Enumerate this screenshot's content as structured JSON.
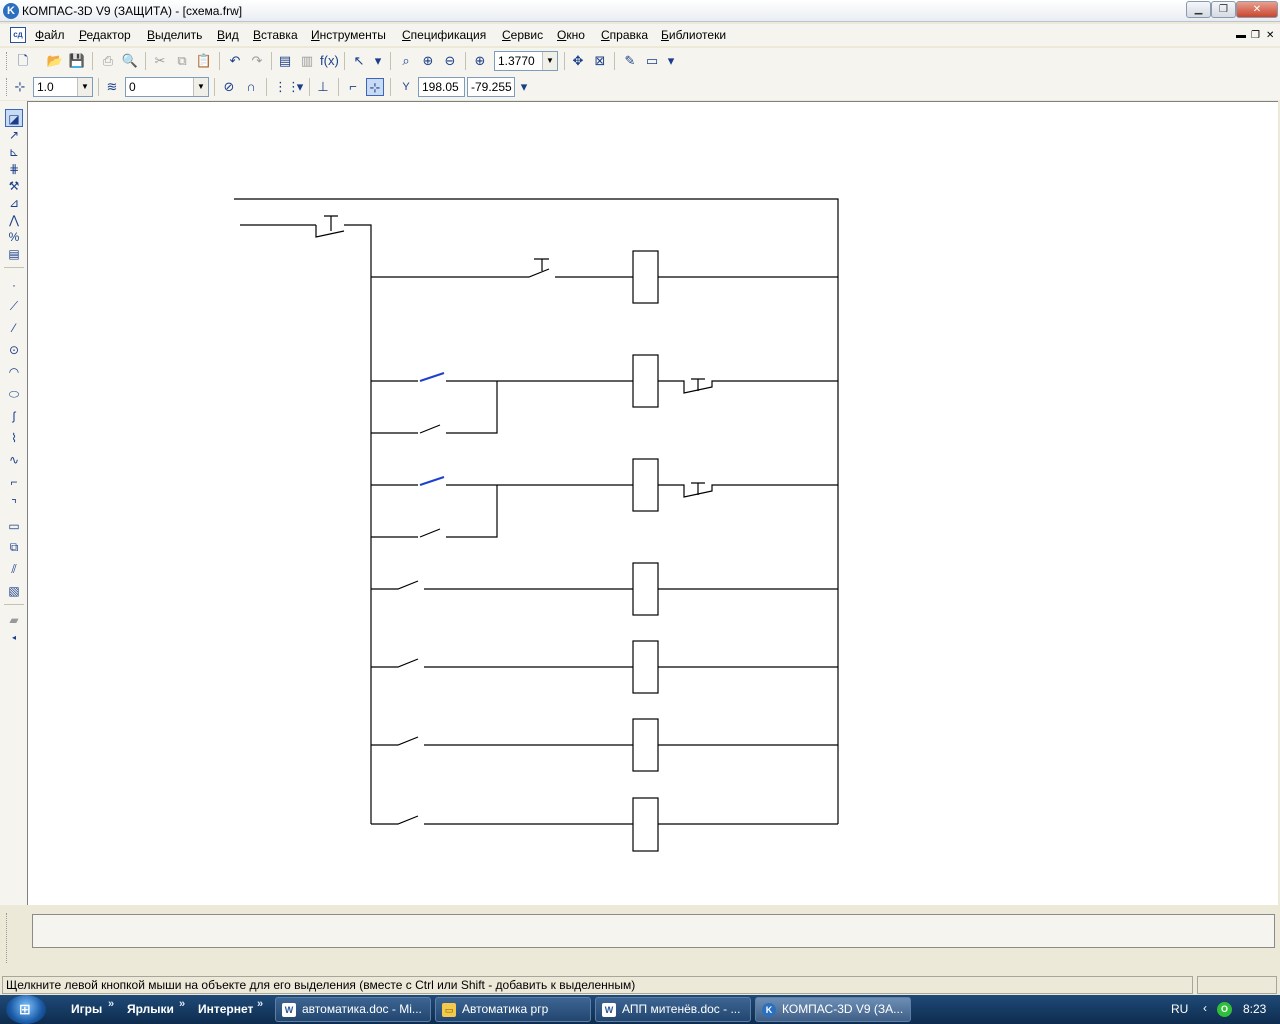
{
  "window": {
    "title": "КОМПАС-3D V9 (ЗАЩИТА) - [схема.frw]",
    "app_icon": "kompas-icon"
  },
  "menu": {
    "items": [
      "Файл",
      "Редактор",
      "Выделить",
      "Вид",
      "Вставка",
      "Инструменты",
      "Спецификация",
      "Сервис",
      "Окно",
      "Справка",
      "Библиотеки"
    ]
  },
  "toolbar1": {
    "zoom_value": "1.3770",
    "icons": [
      "new-file-icon",
      "open-icon",
      "save-icon",
      "print-icon",
      "print-preview-icon",
      "cut-icon",
      "copy-icon",
      "paste-icon",
      "undo-icon",
      "redo-icon",
      "manager-icon",
      "properties-icon",
      "function-icon",
      "select-cursor-icon",
      "zoom-window-icon",
      "zoom-in-icon",
      "zoom-out-icon",
      "zoom-scale-icon",
      "pan-icon",
      "zoom-all-icon",
      "refresh-icon",
      "view-mode-icon"
    ]
  },
  "toolbar2": {
    "step_value": "1.0",
    "layer_value": "0",
    "coord_label": "Y",
    "coord_x": "198.05",
    "coord_y": "-79.255",
    "icons": [
      "current-state-icon",
      "layers-icon",
      "snap-icon",
      "snap-magnet-icon",
      "grid-icon",
      "local-cs-icon",
      "ortho-icon",
      "round-icon"
    ]
  },
  "left_panel": {
    "icons": [
      "geometry-icon",
      "dimensions-icon",
      "symbols-icon",
      "editing-icon",
      "parametrization-icon",
      "measure-icon",
      "select-icon",
      "spec-icon",
      "point-icon",
      "auxiliary-line-icon",
      "segment-icon",
      "circle-icon",
      "arc-icon",
      "ellipse-icon",
      "continuous-line-icon",
      "polyline-icon",
      "bezier-icon",
      "fillet-icon",
      "chamfer-icon",
      "rectangle-icon",
      "macro-icon",
      "hatch-icon",
      "equidistant-icon",
      "fill-icon"
    ]
  },
  "status": {
    "text": "Щелкните левой кнопкой мыши на объекте для его выделения (вместе с Ctrl или Shift - добавить к выделенным)"
  },
  "taskbar": {
    "quick_links": [
      "Игры",
      "Ярлыки",
      "Интернет"
    ],
    "tasks": [
      "автоматика.doc - Mi...",
      "Автоматика ргр",
      "АПП митенёв.doc - ...",
      "КОМПАС-3D V9 (ЗА..."
    ],
    "active_task": 3,
    "tray_lang": "RU",
    "clock": "8:23"
  },
  "colors": {
    "highlight_line": "#1f3fd0",
    "line": "#000000",
    "canvas": "#ffffff"
  }
}
